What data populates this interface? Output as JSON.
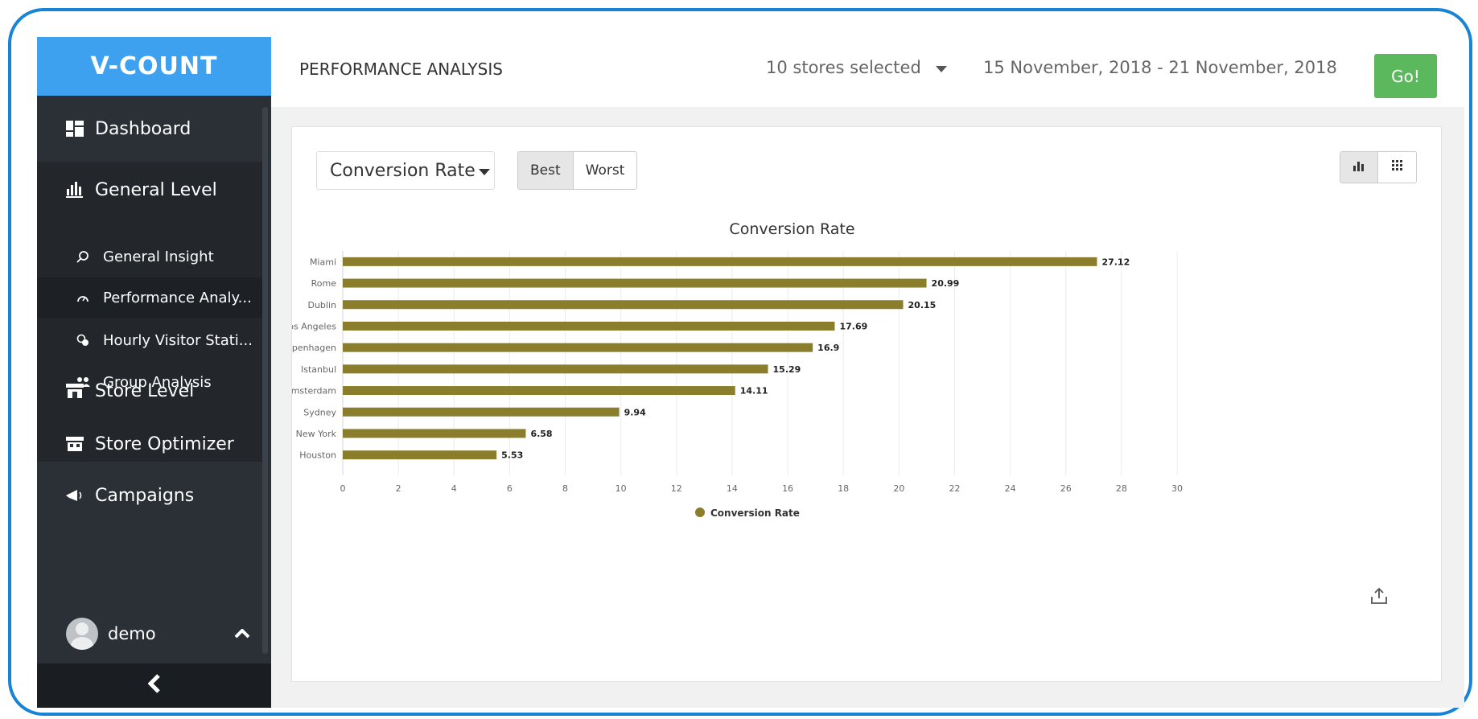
{
  "app": {
    "logo": "V-COUNT"
  },
  "sidebar": {
    "dashboard": {
      "icon": "dashboard-icon",
      "label": "Dashboard"
    },
    "general_level": {
      "icon": "bar-chart-icon",
      "label": "General Level"
    },
    "sub_items": [
      {
        "icon": "search-icon",
        "label": "General Insight"
      },
      {
        "icon": "gauge-icon",
        "label": "Performance Analy..."
      },
      {
        "icon": "clock-icon",
        "label": "Hourly Visitor Stati..."
      },
      {
        "icon": "group-icon",
        "label": "Group Analysis"
      }
    ],
    "store_level": {
      "icon": "store-icon",
      "label": "Store Level"
    },
    "store_optimizer": {
      "icon": "store-optimizer-icon",
      "label": "Store Optimizer"
    },
    "campaigns": {
      "icon": "megaphone-icon",
      "label": "Campaigns"
    },
    "user": {
      "name": "demo",
      "icon": "chevron-up-icon"
    },
    "collapse_icon": "chevron-left-icon"
  },
  "header": {
    "title": "PERFORMANCE ANALYSIS",
    "stores": "10 stores selected",
    "dates": "15 November, 2018 - 21 November, 2018",
    "go_label": "Go!"
  },
  "controls": {
    "metric": "Conversion Rate",
    "best_label": "Best",
    "worst_label": "Worst",
    "view_chart_icon": "bar-chart-icon",
    "view_grid_icon": "grid-icon"
  },
  "colors": {
    "bar": "#8a7e2d",
    "accent": "#3ea1f0",
    "go": "#5cb85c"
  },
  "chart_data": {
    "type": "bar",
    "orientation": "horizontal",
    "title": "Conversion Rate",
    "categories": [
      "Miami",
      "Rome",
      "Dublin",
      "Los Angeles",
      "Copenhagen",
      "Istanbul",
      "Amsterdam",
      "Sydney",
      "New York",
      "Houston"
    ],
    "values": [
      27.12,
      20.99,
      20.15,
      17.69,
      16.9,
      15.29,
      14.11,
      9.94,
      6.58,
      5.53
    ],
    "value_labels": [
      "27.12",
      "20.99",
      "20.15",
      "17.69",
      "16.9",
      "15.29",
      "14.11",
      "9.94",
      "6.58",
      "5.53"
    ],
    "xlim": [
      0,
      30
    ],
    "xticks": [
      0,
      2,
      4,
      6,
      8,
      10,
      12,
      14,
      16,
      18,
      20,
      22,
      24,
      26,
      28,
      30
    ],
    "grid": true,
    "legend": "bottom-center",
    "series": [
      {
        "name": "Conversion Rate",
        "values": [
          27.12,
          20.99,
          20.15,
          17.69,
          16.9,
          15.29,
          14.11,
          9.94,
          6.58,
          5.53
        ]
      }
    ]
  }
}
